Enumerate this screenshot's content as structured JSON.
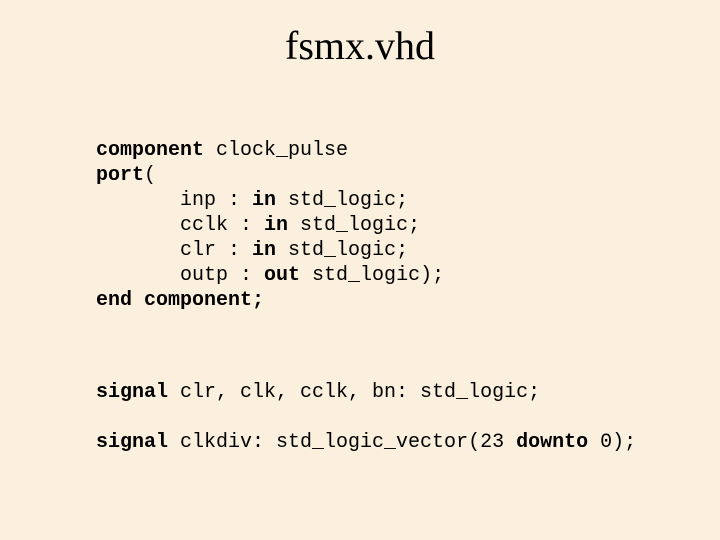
{
  "title": "fsmx.vhd",
  "code1": {
    "l1a": "component",
    "l1b": " clock_pulse",
    "l2a": "port",
    "l2b": "(",
    "l3": "       inp : ",
    "l3k": "in",
    "l3b": " std_logic;",
    "l4": "       cclk : ",
    "l4k": "in",
    "l4b": " std_logic;",
    "l5": "       clr : ",
    "l5k": "in",
    "l5b": " std_logic;",
    "l6": "       outp : ",
    "l6k": "out",
    "l6b": " std_logic);",
    "l7": "end component;"
  },
  "code2": {
    "l1a": "signal",
    "l1b": " clr, clk, cclk, bn: std_logic;",
    "l2a": "signal",
    "l2b": " clkdiv: std_logic_vector(23 ",
    "l2k": "downto",
    "l2c": " 0);"
  }
}
